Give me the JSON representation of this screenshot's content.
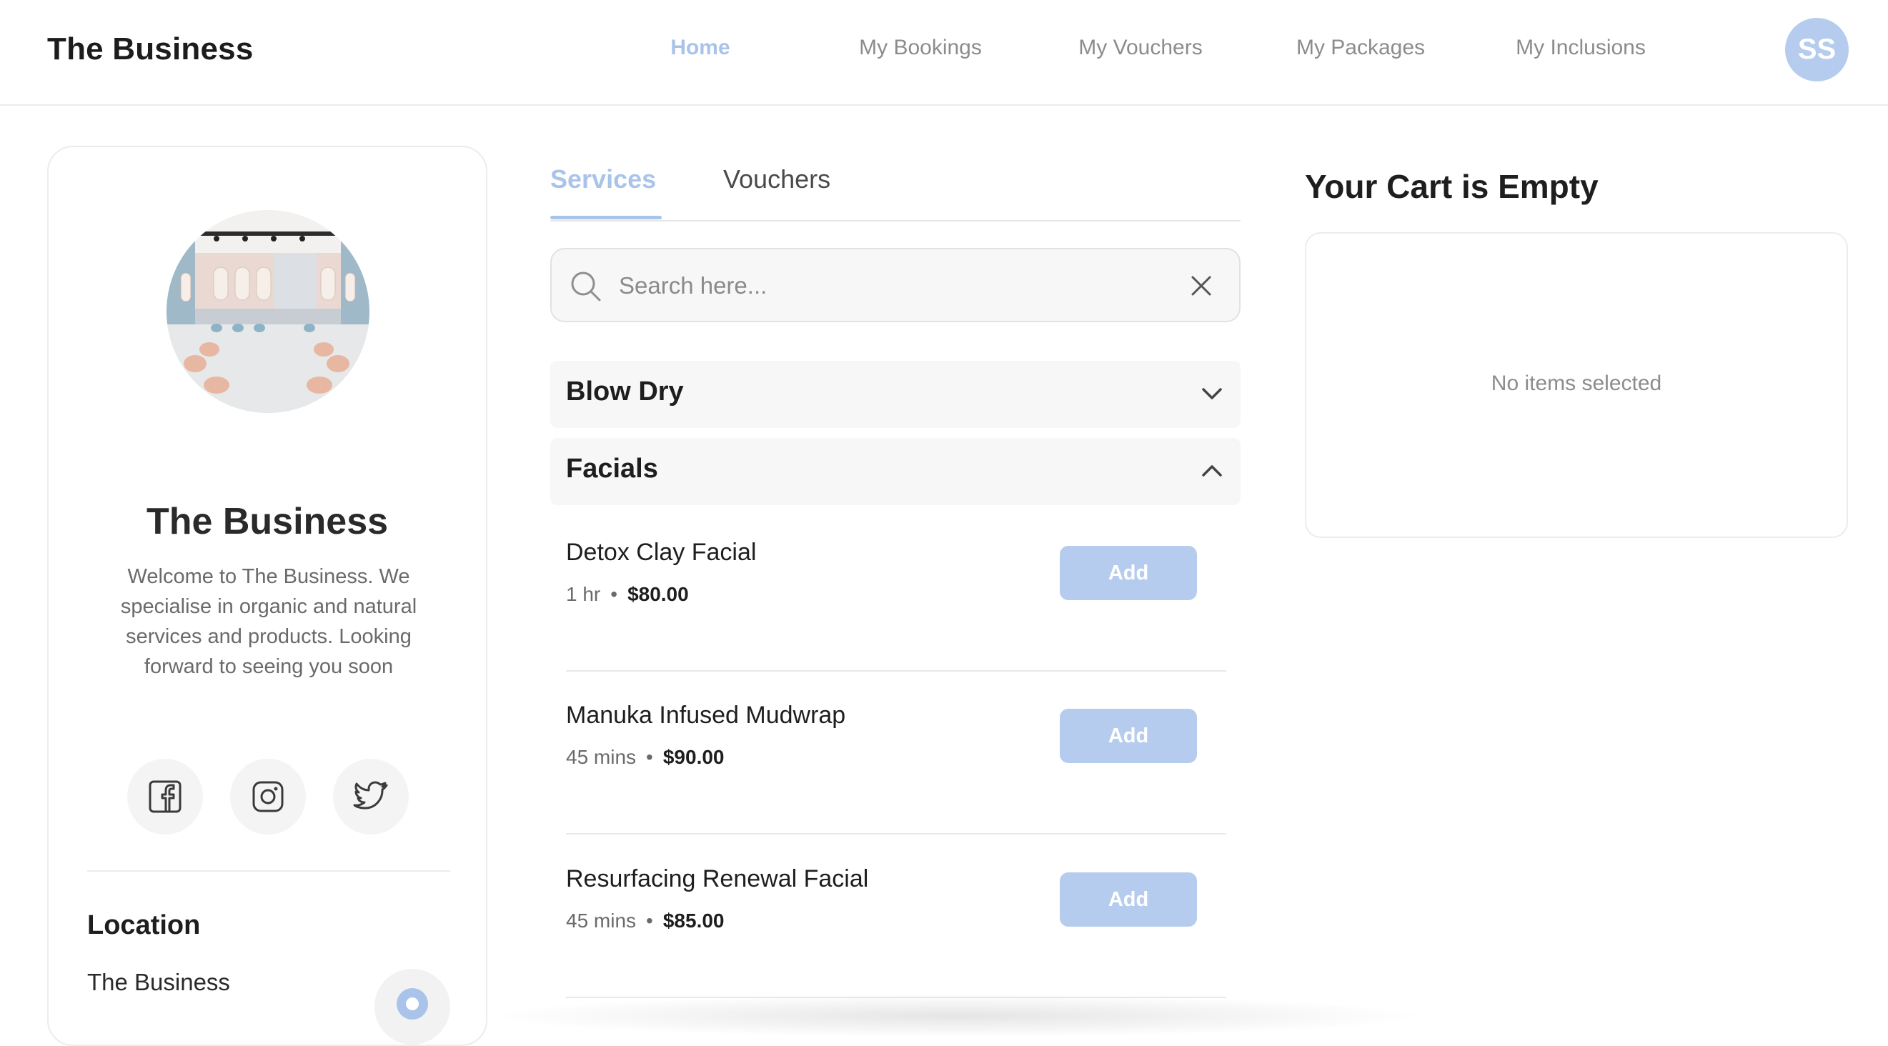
{
  "header": {
    "brand": "The Business",
    "nav": [
      {
        "label": "Home",
        "active": true
      },
      {
        "label": "My Bookings",
        "active": false
      },
      {
        "label": "My Vouchers",
        "active": false
      },
      {
        "label": "My Packages",
        "active": false
      },
      {
        "label": "My Inclusions",
        "active": false
      }
    ],
    "avatar_initials": "SS"
  },
  "profile": {
    "name": "The Business",
    "description": "Welcome to The Business. We specialise in organic and natural services and products. Looking forward to seeing you soon",
    "social": [
      {
        "icon": "facebook-icon"
      },
      {
        "icon": "instagram-icon"
      },
      {
        "icon": "twitter-icon"
      }
    ],
    "location_heading": "Location",
    "location_name": "The Business"
  },
  "tabs": [
    {
      "label": "Services",
      "active": true
    },
    {
      "label": "Vouchers",
      "active": false
    }
  ],
  "search": {
    "placeholder": "Search here...",
    "value": ""
  },
  "categories": [
    {
      "title": "Blow Dry",
      "expanded": false
    },
    {
      "title": "Facials",
      "expanded": true,
      "services": [
        {
          "name": "Detox Clay Facial",
          "duration": "1 hr",
          "price": "$80.00",
          "button": "Add"
        },
        {
          "name": "Manuka Infused Mudwrap",
          "duration": "45 mins",
          "price": "$90.00",
          "button": "Add"
        },
        {
          "name": "Resurfacing Renewal Facial",
          "duration": "45 mins",
          "price": "$85.00",
          "button": "Add"
        }
      ]
    }
  ],
  "cart": {
    "title": "Your Cart is Empty",
    "empty_message": "No items selected"
  },
  "colors": {
    "accent": "#a9c3ea",
    "button": "#b6ccee",
    "muted_text": "#8c8c8c"
  }
}
